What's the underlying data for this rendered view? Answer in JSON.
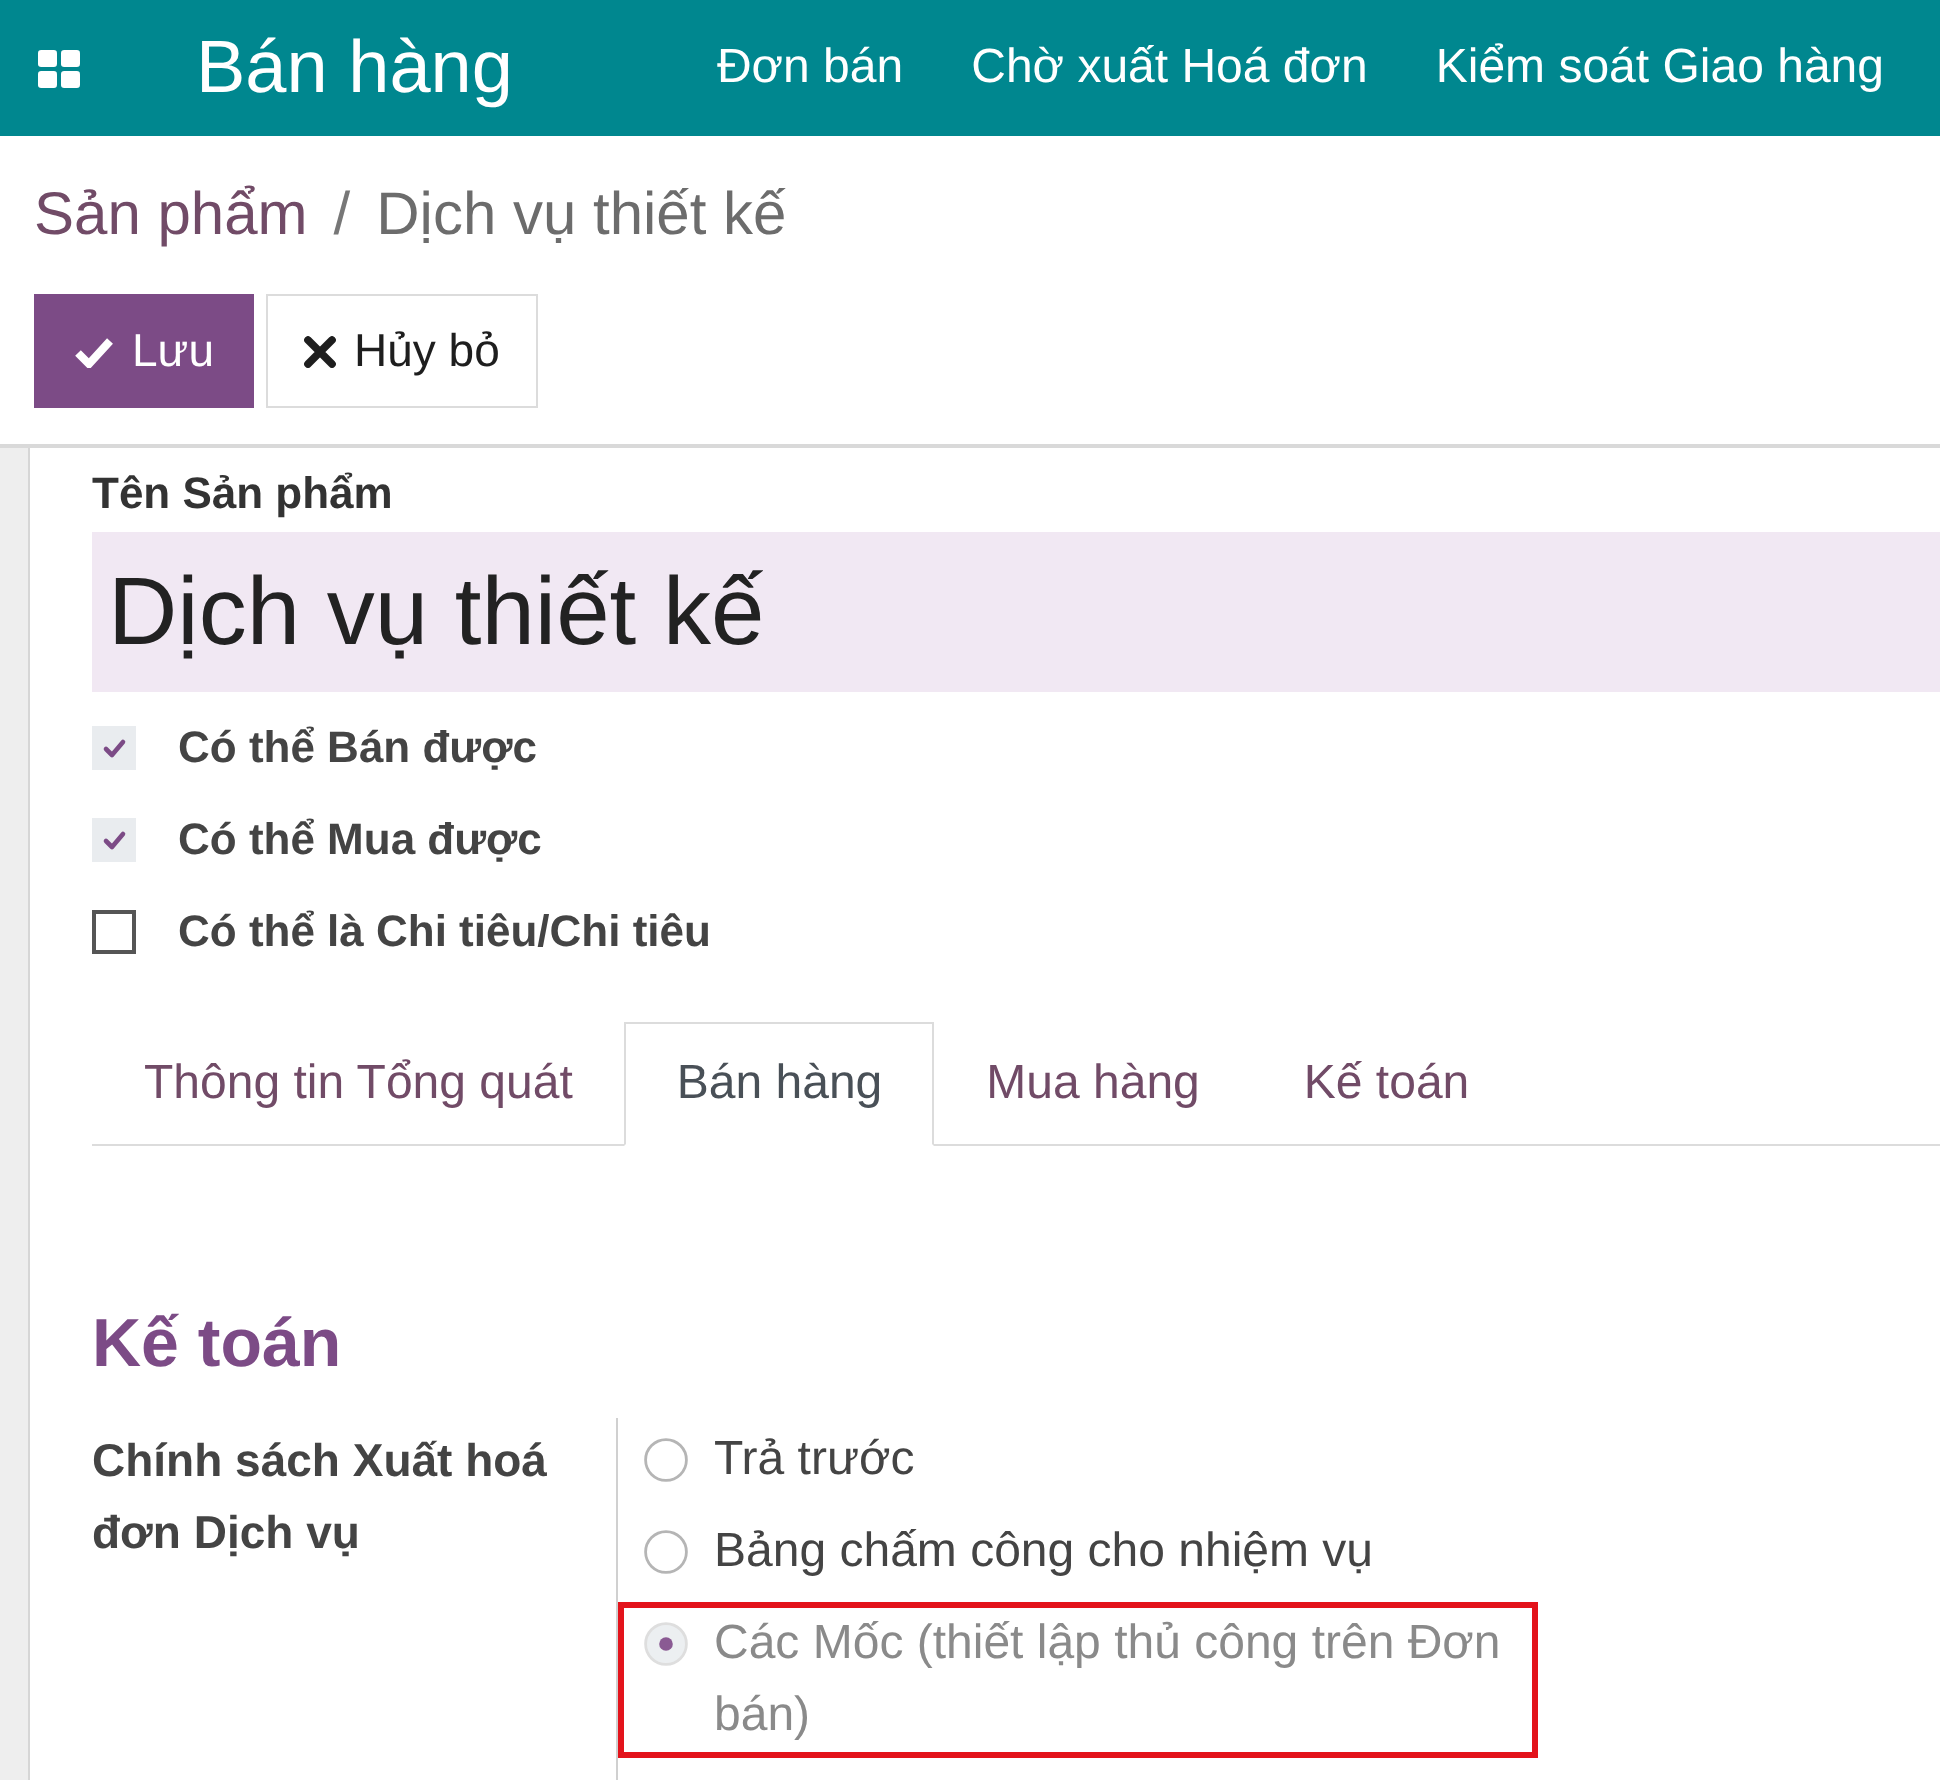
{
  "top_bar": {
    "app_title": "Bán hàng",
    "menu": [
      "Đơn bán",
      "Chờ xuất Hoá đơn",
      "Kiểm soát Giao hàng"
    ]
  },
  "breadcrumb": {
    "separator": "/",
    "items": [
      {
        "label": "Sản phẩm",
        "kind": "link"
      },
      {
        "label": "Dịch vụ thiết kế",
        "kind": "current"
      }
    ]
  },
  "buttons": [
    {
      "label": "Lưu",
      "kind": "save"
    },
    {
      "label": "Hủy bỏ",
      "kind": "cancel"
    }
  ],
  "form": {
    "name_label": "Tên Sản phẩm",
    "name_value": "Dịch vụ thiết kế",
    "checkboxes": [
      {
        "label": "Có thể Bán được",
        "checked": true
      },
      {
        "label": "Có thể Mua được",
        "checked": true
      },
      {
        "label": "Có thể là Chi tiêu/Chi tiêu",
        "checked": false
      }
    ],
    "tabs": [
      {
        "label": "Thông tin Tổng quát",
        "selected": false
      },
      {
        "label": "Bán hàng",
        "selected": true
      },
      {
        "label": "Mua hàng",
        "selected": false
      },
      {
        "label": "Kế toán",
        "selected": false
      }
    ],
    "section_title": "Kế toán",
    "invoicing_policy": {
      "label": "Chính sách Xuất hoá đơn Dịch vụ",
      "options": [
        {
          "label": "Trả trước",
          "selected": false,
          "disabled": false,
          "highlighted": false
        },
        {
          "label": "Bảng chấm công cho nhiệm vụ",
          "selected": false,
          "disabled": false,
          "highlighted": false
        },
        {
          "label": "Các Mốc (thiết lập thủ công trên Đơn bán)",
          "selected": true,
          "disabled": true,
          "highlighted": true
        }
      ]
    }
  }
}
